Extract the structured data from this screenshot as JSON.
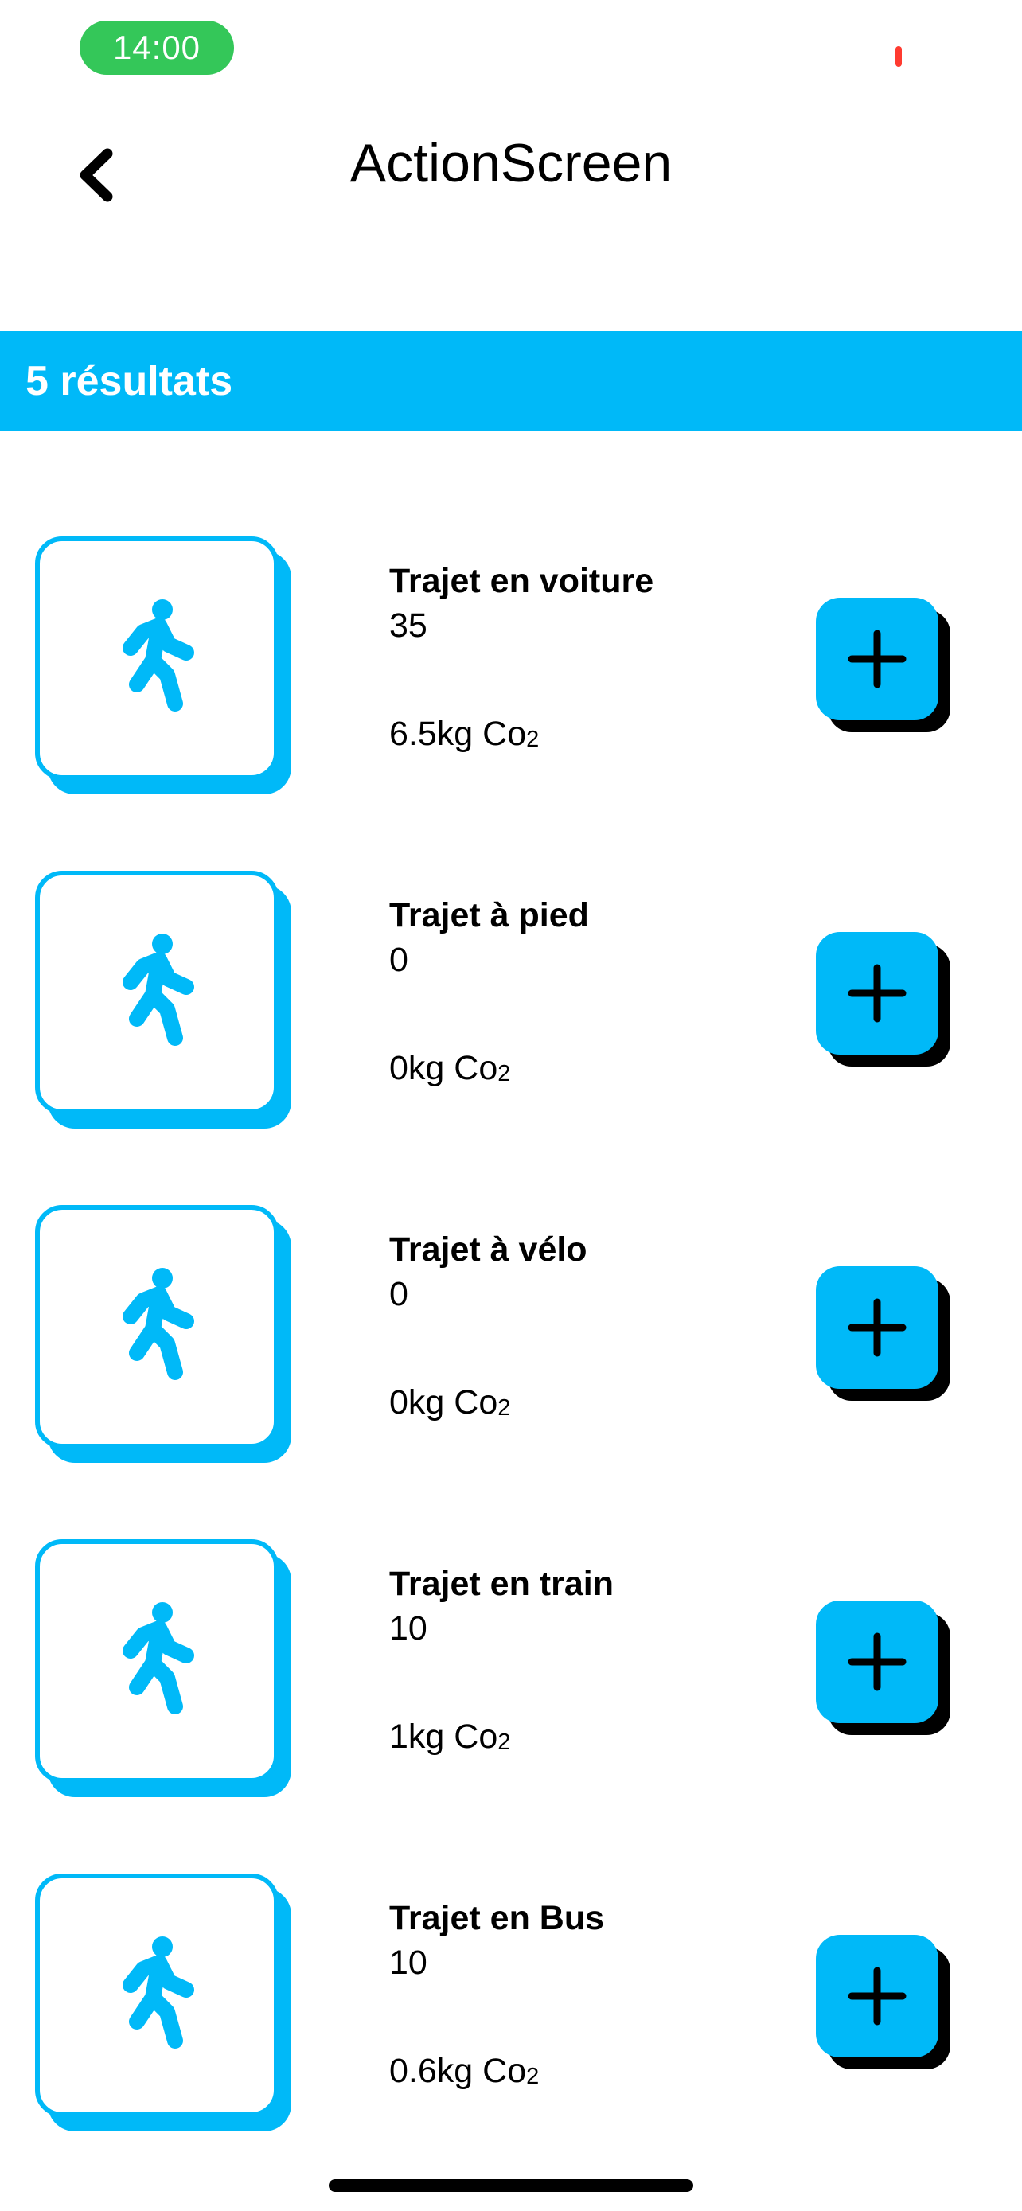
{
  "status_bar": {
    "time": "14:00"
  },
  "nav": {
    "title": "ActionScreen",
    "back_icon": "chevron-left-icon"
  },
  "results": {
    "label": "5 résultats"
  },
  "colors": {
    "accent": "#00b9f8",
    "status_pill": "#34c759",
    "shadow": "#000000"
  },
  "actions": [
    {
      "title": "Trajet en voiture",
      "value": "35",
      "co2_amount": "6.5kg Co",
      "co2_sub": "2",
      "icon": "walking-person-icon"
    },
    {
      "title": "Trajet à pied",
      "value": "0",
      "co2_amount": "0kg Co",
      "co2_sub": "2",
      "icon": "walking-person-icon"
    },
    {
      "title": "Trajet à vélo",
      "value": "0",
      "co2_amount": "0kg Co",
      "co2_sub": "2",
      "icon": "walking-person-icon"
    },
    {
      "title": "Trajet en train",
      "value": "10",
      "co2_amount": "1kg Co",
      "co2_sub": "2",
      "icon": "walking-person-icon"
    },
    {
      "title": "Trajet en Bus",
      "value": "10",
      "co2_amount": "0.6kg Co",
      "co2_sub": "2",
      "icon": "walking-person-icon"
    }
  ]
}
